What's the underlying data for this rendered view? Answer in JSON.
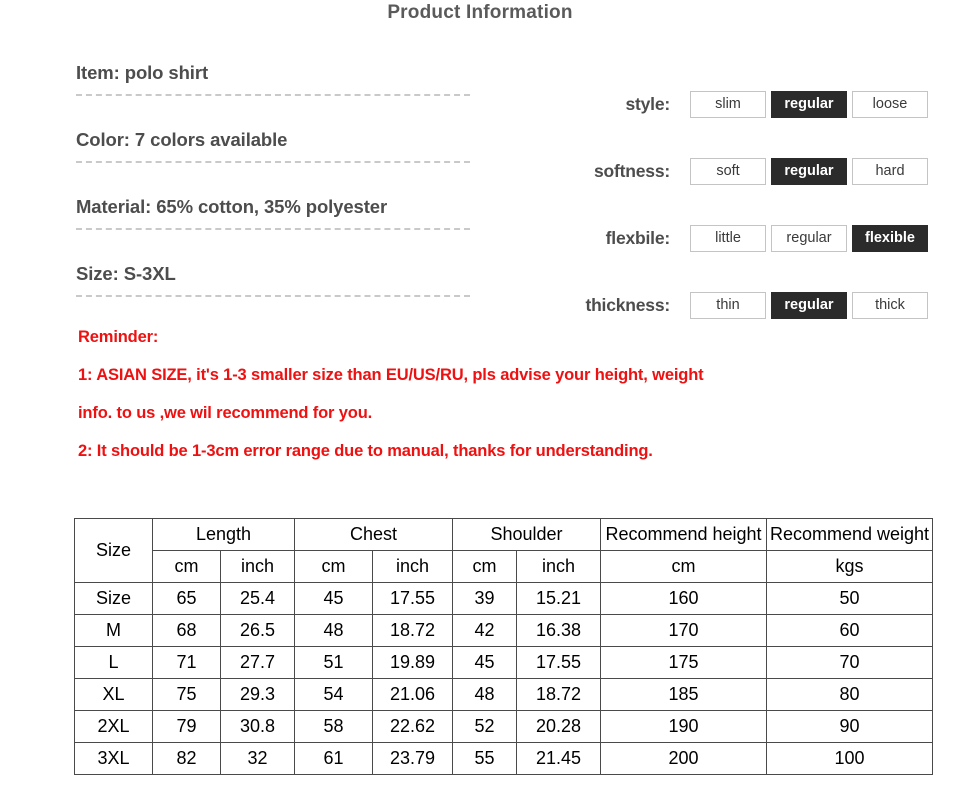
{
  "title": "Product Information",
  "specs": [
    {
      "text": "Item: polo shirt"
    },
    {
      "text": "Color: 7 colors available"
    },
    {
      "text": "Material: 65% cotton, 35% polyester"
    },
    {
      "text": "Size: S-3XL"
    }
  ],
  "attributes": [
    {
      "label": "style:",
      "options": [
        {
          "text": "slim",
          "selected": false
        },
        {
          "text": "regular",
          "selected": true
        },
        {
          "text": "loose",
          "selected": false
        }
      ]
    },
    {
      "label": "softness:",
      "options": [
        {
          "text": "soft",
          "selected": false
        },
        {
          "text": "regular",
          "selected": true
        },
        {
          "text": "hard",
          "selected": false
        }
      ]
    },
    {
      "label": "flexbile:",
      "options": [
        {
          "text": "little",
          "selected": false
        },
        {
          "text": "regular",
          "selected": false
        },
        {
          "text": "flexible",
          "selected": true
        }
      ]
    },
    {
      "label": "thickness:",
      "options": [
        {
          "text": "thin",
          "selected": false
        },
        {
          "text": "regular",
          "selected": true
        },
        {
          "text": "thick",
          "selected": false
        }
      ]
    }
  ],
  "reminder": {
    "heading": "Reminder:",
    "lines": [
      "1: ASIAN SIZE, it's 1-3 smaller size than EU/US/RU, pls advise your height, weight",
      "info. to us ,we wil recommend for you.",
      "2: It should be 1-3cm error range due to manual, thanks for understanding."
    ]
  },
  "size_table": {
    "group_headers": [
      "Size",
      "Length",
      "Chest",
      "Shoulder",
      "Recommend height",
      "Recommend weight"
    ],
    "unit_headers": [
      "",
      "cm",
      "inch",
      "cm",
      "inch",
      "cm",
      "inch",
      "cm",
      "kgs"
    ],
    "rows": [
      [
        "Size",
        "65",
        "25.4",
        "45",
        "17.55",
        "39",
        "15.21",
        "160",
        "50"
      ],
      [
        "M",
        "68",
        "26.5",
        "48",
        "18.72",
        "42",
        "16.38",
        "170",
        "60"
      ],
      [
        "L",
        "71",
        "27.7",
        "51",
        "19.89",
        "45",
        "17.55",
        "175",
        "70"
      ],
      [
        "XL",
        "75",
        "29.3",
        "54",
        "21.06",
        "48",
        "18.72",
        "185",
        "80"
      ],
      [
        "2XL",
        "79",
        "30.8",
        "58",
        "22.62",
        "52",
        "20.28",
        "190",
        "90"
      ],
      [
        "3XL",
        "82",
        "32",
        "61",
        "23.79",
        "55",
        "21.45",
        "200",
        "100"
      ]
    ]
  },
  "colors": {
    "title_gray": "#5a5a5a",
    "spec_gray": "#4d4d4d",
    "reminder_red": "#ee1111",
    "selected_bg": "#2b2b2b",
    "table_border": "#4a4a4a"
  }
}
